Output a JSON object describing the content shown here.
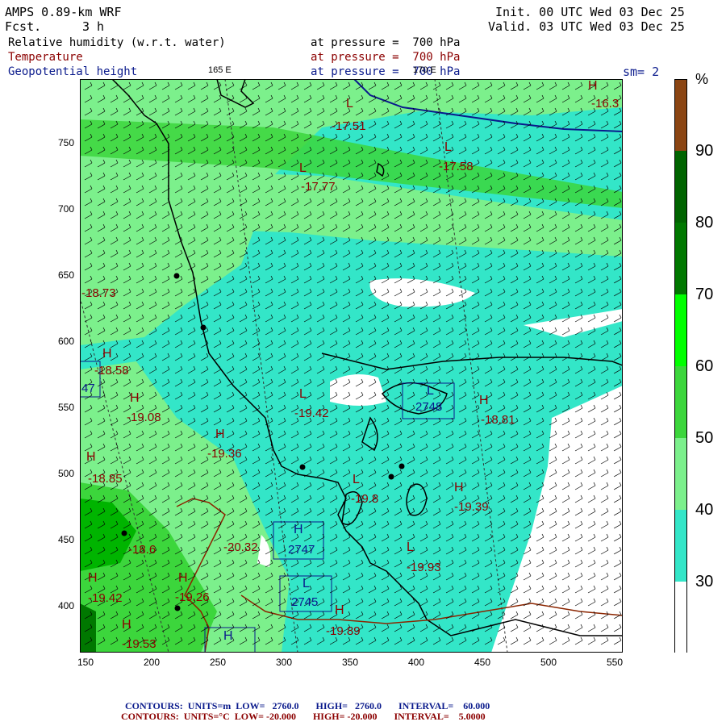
{
  "header": {
    "model": "AMPS 0.89-km WRF",
    "fcst_label": "Fcst.",
    "fcst_value": "3 h",
    "init": "Init. 00 UTC Wed 03 Dec 25",
    "valid": "Valid. 03 UTC Wed 03 Dec 25",
    "field1": "Relative humidity (w.r.t. water)",
    "field1_level": "at pressure =  700 hPa",
    "field2": "Temperature",
    "field2_level": "at pressure =  700 hPa",
    "field3": "Geopotential height",
    "field3_level": "at pressure =  700 hPa",
    "lon_label_165": "165 E",
    "lon_label_170": "170 E",
    "smooth": "sm= 2"
  },
  "axes": {
    "x_ticks": [
      "150",
      "200",
      "250",
      "300",
      "350",
      "400",
      "450",
      "500",
      "550"
    ],
    "y_ticks": [
      "750",
      "700",
      "650",
      "600",
      "550",
      "500",
      "450",
      "400"
    ]
  },
  "colorbar": {
    "unit": "%",
    "levels": [
      "30",
      "40",
      "50",
      "60",
      "70",
      "80",
      "90"
    ],
    "colors": [
      "#ffffff",
      "#33e6c8",
      "#7cf08c",
      "#3cd63c",
      "#00ff00",
      "#00b400",
      "#007800",
      "#006400",
      "#8b4513"
    ]
  },
  "labels": {
    "temps": [
      "-17.51",
      "-17.58",
      "-17.77",
      "-16.3",
      "-18.73",
      "-18.58",
      "-19.08",
      "-19.36",
      "-18.85",
      "-19.42",
      "-18.81",
      "-19.8",
      "-19.39",
      "-18.6",
      "-20.32",
      "-19.93",
      "-19.42",
      "-19.26",
      "-19.89",
      "-19.53"
    ],
    "heights": [
      "2748",
      "2747",
      "2745",
      "47"
    ],
    "marks": [
      "L",
      "H"
    ]
  },
  "footer": {
    "line1": "CONTOURS:  UNITS=m  LOW=   2760.0       HIGH=   2760.0       INTERVAL=    60.000",
    "line2": "CONTOURS:  UNITS=°C  LOW= -20.000       HIGH= -20.000       INTERVAL=    5.0000"
  }
}
